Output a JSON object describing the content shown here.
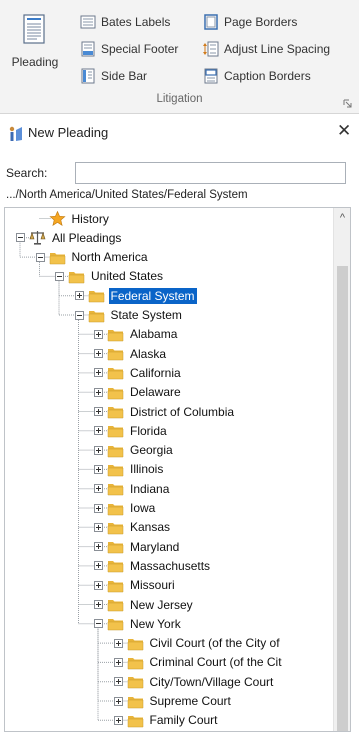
{
  "ribbon": {
    "big_button": {
      "label": "Pleading",
      "icon": "pleading-document-icon"
    },
    "col1": [
      {
        "label": "Bates Labels",
        "icon": "bates-labels-icon"
      },
      {
        "label": "Special Footer",
        "icon": "special-footer-icon"
      },
      {
        "label": "Side Bar",
        "icon": "side-bar-icon"
      }
    ],
    "col2": [
      {
        "label": "Page Borders",
        "icon": "page-borders-icon"
      },
      {
        "label": "Adjust Line Spacing",
        "icon": "line-spacing-icon"
      },
      {
        "label": "Caption Borders",
        "icon": "caption-borders-icon"
      }
    ],
    "group_label": "Litigation"
  },
  "pane": {
    "title": "New Pleading",
    "search_label": "Search:",
    "search_value": "",
    "path": ".../North America/United States/Federal System"
  },
  "tree": [
    {
      "label": "History",
      "icon": "star-icon"
    },
    {
      "label": "All Pleadings",
      "icon": "scales-icon",
      "expanded": true
    },
    {
      "label": "North America",
      "icon": "folder-icon",
      "expanded": true
    },
    {
      "label": "United States",
      "icon": "folder-icon",
      "expanded": true
    },
    {
      "label": "Federal System",
      "icon": "folder-icon",
      "expanded": false,
      "selected": true
    },
    {
      "label": "State System",
      "icon": "folder-icon",
      "expanded": true
    },
    {
      "label": "Alabama",
      "icon": "folder-icon"
    },
    {
      "label": "Alaska",
      "icon": "folder-icon"
    },
    {
      "label": "California",
      "icon": "folder-icon"
    },
    {
      "label": "Delaware",
      "icon": "folder-icon"
    },
    {
      "label": "District of Columbia",
      "icon": "folder-icon"
    },
    {
      "label": "Florida",
      "icon": "folder-icon"
    },
    {
      "label": "Georgia",
      "icon": "folder-icon"
    },
    {
      "label": "Illinois",
      "icon": "folder-icon"
    },
    {
      "label": "Indiana",
      "icon": "folder-icon"
    },
    {
      "label": "Iowa",
      "icon": "folder-icon"
    },
    {
      "label": "Kansas",
      "icon": "folder-icon"
    },
    {
      "label": "Maryland",
      "icon": "folder-icon"
    },
    {
      "label": "Massachusetts",
      "icon": "folder-icon"
    },
    {
      "label": "Missouri",
      "icon": "folder-icon"
    },
    {
      "label": "New Jersey",
      "icon": "folder-icon"
    },
    {
      "label": "New York",
      "icon": "folder-icon",
      "expanded": true
    },
    {
      "label": "Civil Court (of the City of",
      "icon": "folder-icon"
    },
    {
      "label": "Criminal Court (of the Cit",
      "icon": "folder-icon"
    },
    {
      "label": "City/Town/Village Court",
      "icon": "folder-icon"
    },
    {
      "label": "Supreme Court",
      "icon": "folder-icon"
    },
    {
      "label": "Family Court",
      "icon": "folder-icon"
    }
  ],
  "colors": {
    "selection": "#0a64c8",
    "folder": "#f2c24b",
    "ribbon_bg": "#f3f3f3"
  }
}
